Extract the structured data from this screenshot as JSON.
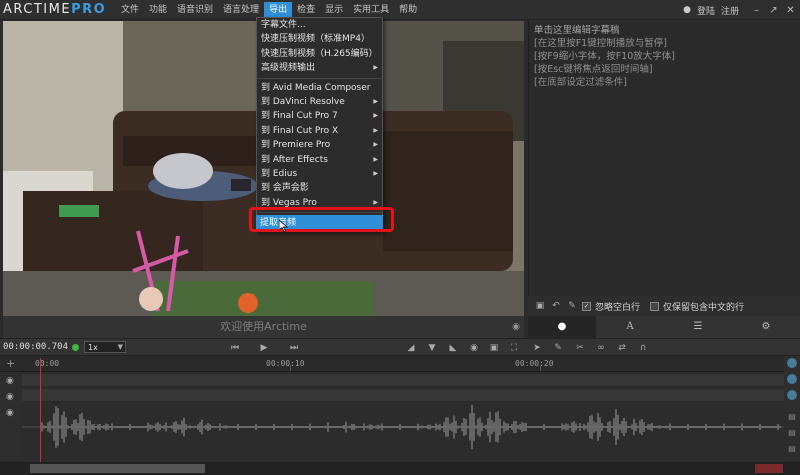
{
  "app": {
    "logo_main": "ARCTIME",
    "logo_pro": "PRO"
  },
  "menu": [
    "文件",
    "功能",
    "语音识别",
    "语言处理",
    "导出",
    "检查",
    "显示",
    "实用工具",
    "帮助"
  ],
  "titlebar_right": {
    "login": "登陆",
    "register": "注册"
  },
  "export_menu": {
    "items": [
      "字幕文件...",
      "快速压制视频（标准MP4）",
      "快速压制视频（H.265编码）",
      "高级视频输出"
    ],
    "targets": [
      "到 Avid Media Composer",
      "到 DaVinci Resolve",
      "到 Final Cut Pro 7",
      "到 Final Cut Pro X",
      "到 Premiere Pro",
      "到 After Effects",
      "到 Edius",
      "到 会声会影",
      "到 Vegas Pro"
    ],
    "extract_audio": "提取音频"
  },
  "subtitle_panel": {
    "lines": [
      "单击这里编辑字幕稿",
      "[在这里按F1键控制播放与暂停]",
      "[按F9缩小字体，按F10放大字体]",
      "[按Esc键将焦点返回时间轴]",
      "[在底部设定过滤条件]"
    ]
  },
  "filters": {
    "ignore_empty": "忽略空白行",
    "only_chinese": "仅保留包含中文的行"
  },
  "caption_bar": {
    "welcome": "欢迎使用Arctime"
  },
  "controls": {
    "timecode": "00:00:00.704",
    "speed": "1x"
  },
  "timeline": {
    "labels": [
      "00:00",
      "00:00:10",
      "00:00:20"
    ]
  },
  "colors": {
    "accent": "#2f8fd8",
    "highlight_box": "#e0141a",
    "playhead": "#d0302a",
    "status_dot": "#3cba3c"
  }
}
